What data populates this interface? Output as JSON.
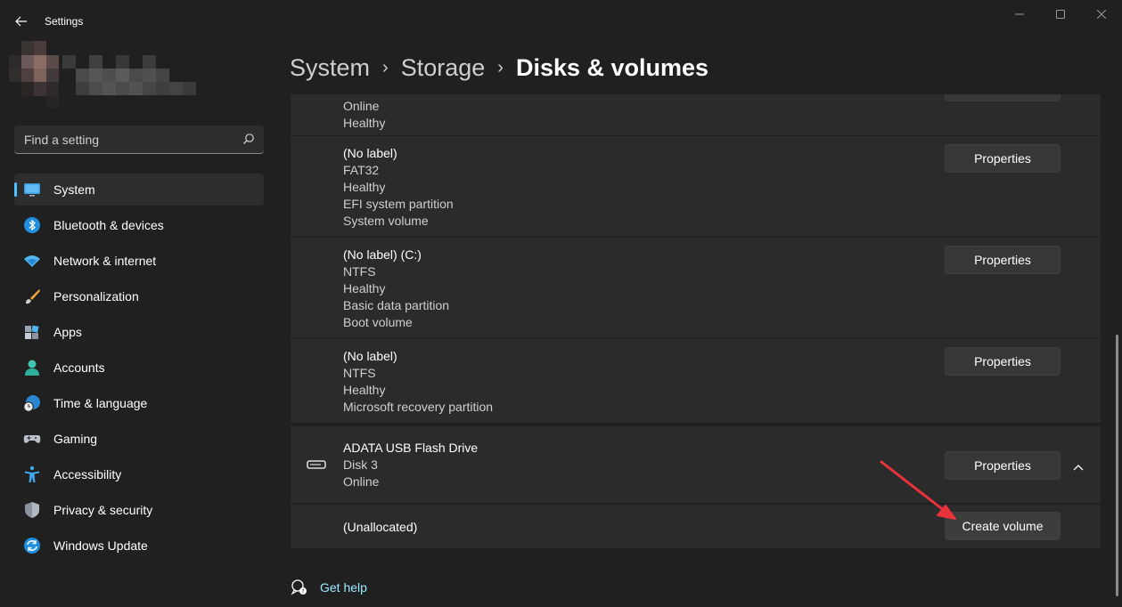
{
  "window": {
    "title": "Settings",
    "controls": {
      "minimize": "—",
      "maximize": "☐",
      "close": "✕"
    }
  },
  "search": {
    "placeholder": "Find a setting"
  },
  "sidebar": {
    "items": [
      {
        "label": "System",
        "icon": "monitor-icon",
        "active": true
      },
      {
        "label": "Bluetooth & devices",
        "icon": "bluetooth-icon"
      },
      {
        "label": "Network & internet",
        "icon": "wifi-icon"
      },
      {
        "label": "Personalization",
        "icon": "brush-icon"
      },
      {
        "label": "Apps",
        "icon": "apps-icon"
      },
      {
        "label": "Accounts",
        "icon": "person-icon"
      },
      {
        "label": "Time & language",
        "icon": "globe-clock-icon"
      },
      {
        "label": "Gaming",
        "icon": "gamepad-icon"
      },
      {
        "label": "Accessibility",
        "icon": "accessibility-icon"
      },
      {
        "label": "Privacy & security",
        "icon": "shield-icon"
      },
      {
        "label": "Windows Update",
        "icon": "sync-icon"
      }
    ]
  },
  "breadcrumb": {
    "items": [
      "System",
      "Storage",
      "Disks & volumes"
    ]
  },
  "volumes": [
    {
      "lines": [
        "Online",
        "Healthy"
      ]
    },
    {
      "lines": [
        "(No label)",
        "FAT32",
        "Healthy",
        "EFI system partition",
        "System volume"
      ],
      "button": "Properties"
    },
    {
      "lines": [
        "(No label) (C:)",
        "NTFS",
        "Healthy",
        "Basic data partition",
        "Boot volume"
      ],
      "button": "Properties"
    },
    {
      "lines": [
        "(No label)",
        "NTFS",
        "Healthy",
        "Microsoft recovery partition"
      ],
      "button": "Properties"
    }
  ],
  "usb_disk": {
    "name": "ADATA USB Flash Drive",
    "disk": "Disk 3",
    "status": "Online",
    "button": "Properties",
    "unallocated": "(Unallocated)",
    "create_button": "Create volume"
  },
  "help": {
    "label": "Get help"
  },
  "colors": {
    "accent": "#4cc2ff",
    "annotation_arrow": "#e8323c"
  }
}
